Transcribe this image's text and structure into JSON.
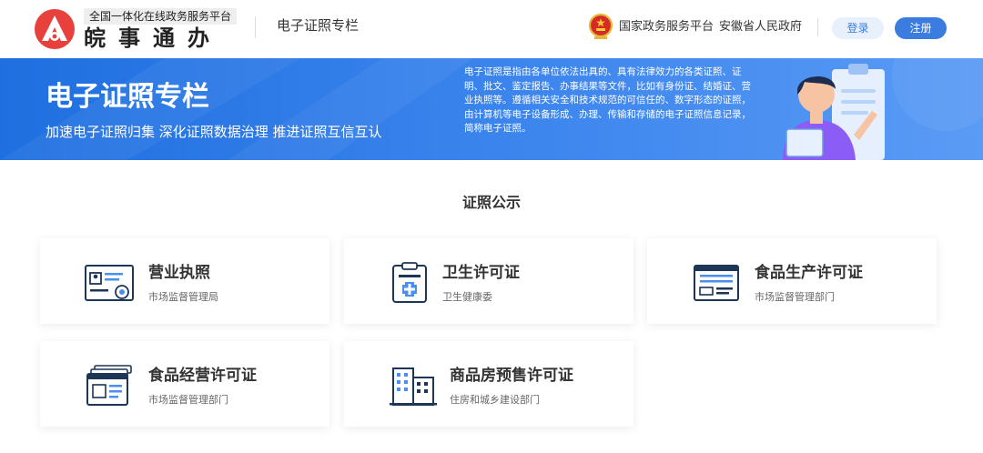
{
  "header": {
    "logo_subtitle": "全国一体化在线政务服务平台",
    "logo_name": "皖事通办",
    "column_title": "电子证照专栏",
    "gov_platform_link": "国家政务服务平台",
    "province_link": "安徽省人民政府",
    "login_label": "登录",
    "register_label": "注册"
  },
  "banner": {
    "title": "电子证照专栏",
    "slogan": "加速电子证照归集  深化证照数据治理  推进证照互信互认",
    "description": "电子证照是指由各单位依法出具的、具有法律效力的各类证照、证明、批文、鉴定报告、办事结果等文件，比如有身份证、结婚证、营业执照等。遵循相关安全和技术规范的可信任的、数字形态的证照，由计算机等电子设备形成、办理、传输和存储的电子证照信息记录，简称电子证照。"
  },
  "section": {
    "title": "证照公示"
  },
  "licenses": [
    {
      "name": "营业执照",
      "dept": "市场监督管理局",
      "icon": "business-license-icon"
    },
    {
      "name": "卫生许可证",
      "dept": "卫生健康委",
      "icon": "health-permit-icon"
    },
    {
      "name": "食品生产许可证",
      "dept": "市场监督管理部门",
      "icon": "food-production-icon"
    },
    {
      "name": "食品经营许可证",
      "dept": "市场监督管理部门",
      "icon": "food-business-icon"
    },
    {
      "name": "商品房预售许可证",
      "dept": "住房和城乡建设部门",
      "icon": "presale-permit-icon"
    }
  ],
  "colors": {
    "brand_red": "#e8403a",
    "primary_blue": "#3a7ce0",
    "icon_navy": "#1d3557",
    "icon_blue": "#4a8ef0"
  }
}
